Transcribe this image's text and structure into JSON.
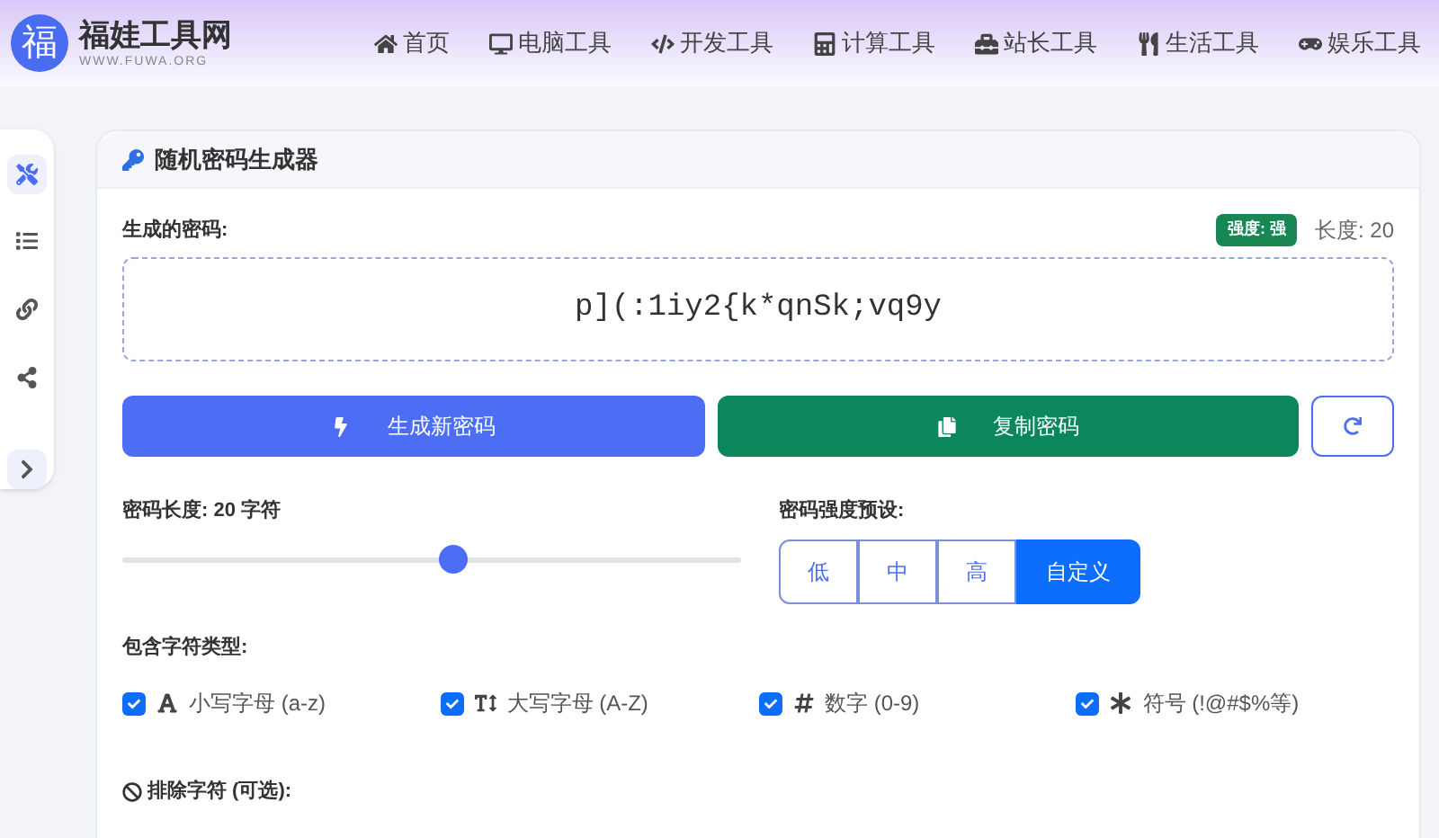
{
  "site": {
    "name": "福娃工具网",
    "domain": "WWW.FUWA.ORG",
    "logo_char": "福"
  },
  "nav": [
    {
      "label": "首页"
    },
    {
      "label": "电脑工具"
    },
    {
      "label": "开发工具"
    },
    {
      "label": "计算工具"
    },
    {
      "label": "站长工具"
    },
    {
      "label": "生活工具"
    },
    {
      "label": "娱乐工具"
    }
  ],
  "sidebar": [
    {
      "selected": true
    },
    {
      "selected": false
    },
    {
      "selected": false
    },
    {
      "selected": false
    },
    {
      "selected": false
    }
  ],
  "panel": {
    "title": "随机密码生成器",
    "generated_label": "生成的密码:",
    "strength_badge": "强度: 强",
    "length_text": "长度: 20",
    "password": "p](:1iy2{k*qnSk;vq9y",
    "buttons": [
      {
        "kind": "generate",
        "label": "生成新密码"
      },
      {
        "kind": "copy",
        "label": "复制密码"
      },
      {
        "kind": "refresh"
      }
    ],
    "length_label": "密码长度: 20 字符",
    "length_slider": {
      "level": 0.535
    },
    "preset_label": "密码强度预设:",
    "presets": [
      {
        "label": "低",
        "selected": false
      },
      {
        "label": "中",
        "selected": false
      },
      {
        "label": "高",
        "selected": false
      },
      {
        "label": "自定义",
        "selected": true
      }
    ],
    "types_label": "包含字符类型:",
    "types": [
      {
        "label": "小写字母",
        "hint": "(a-z)",
        "checked": true
      },
      {
        "label": "大写字母",
        "hint": "(A-Z)",
        "checked": true
      },
      {
        "label": "数字",
        "hint": "(0-9)",
        "checked": true
      },
      {
        "label": "符号",
        "hint": "(!@#$%等)",
        "checked": true
      }
    ],
    "exclude_label": "排除字符 (可选):"
  }
}
